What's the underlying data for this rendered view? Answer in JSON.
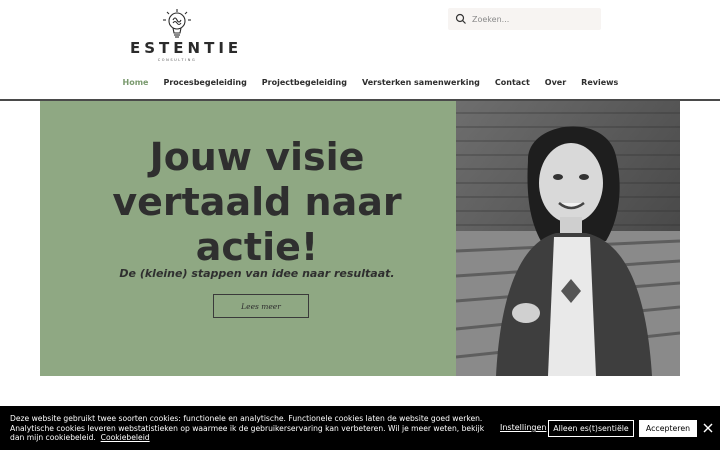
{
  "header": {
    "logo_name": "ESTENTIE",
    "logo_sub": "CONSULTING",
    "logo_icon": "lightbulb-icon"
  },
  "search": {
    "placeholder": "Zoeken...",
    "icon": "search-icon"
  },
  "nav": {
    "items": [
      {
        "label": "Home",
        "active": true
      },
      {
        "label": "Procesbegeleiding",
        "active": false
      },
      {
        "label": "Projectbegeleiding",
        "active": false
      },
      {
        "label": "Versterken samenwerking",
        "active": false
      },
      {
        "label": "Contact",
        "active": false
      },
      {
        "label": "Over",
        "active": false
      },
      {
        "label": "Reviews",
        "active": false
      }
    ]
  },
  "hero": {
    "title_line1": "Jouw visie",
    "title_line2": "vertaald naar",
    "title_line3": "actie!",
    "subtitle": "De (kleine) stappen van idee naar resultaat.",
    "button_label": "Lees meer"
  },
  "photo": {
    "alt": "portrait-photo"
  },
  "cookie": {
    "text": "Deze website gebruikt twee soorten cookies: functionele en analytische. Functionele cookies laten de website goed werken. Analytische cookies leveren webstatistieken op waarmee ik de gebruikerservaring kan verbeteren. Wil je meer weten, bekijk dan mijn cookiebeleid.",
    "policy_link": "Cookiebeleid",
    "settings_label": "Instellingen",
    "essential_label": "Alleen es(t)sentiële",
    "accept_label": "Accepteren",
    "close_icon": "close-icon"
  },
  "colors": {
    "hero_bg": "#8fa883",
    "nav_active": "#7a9a6e",
    "cookie_bg": "#000000",
    "text_dark": "#2f2f2f"
  }
}
